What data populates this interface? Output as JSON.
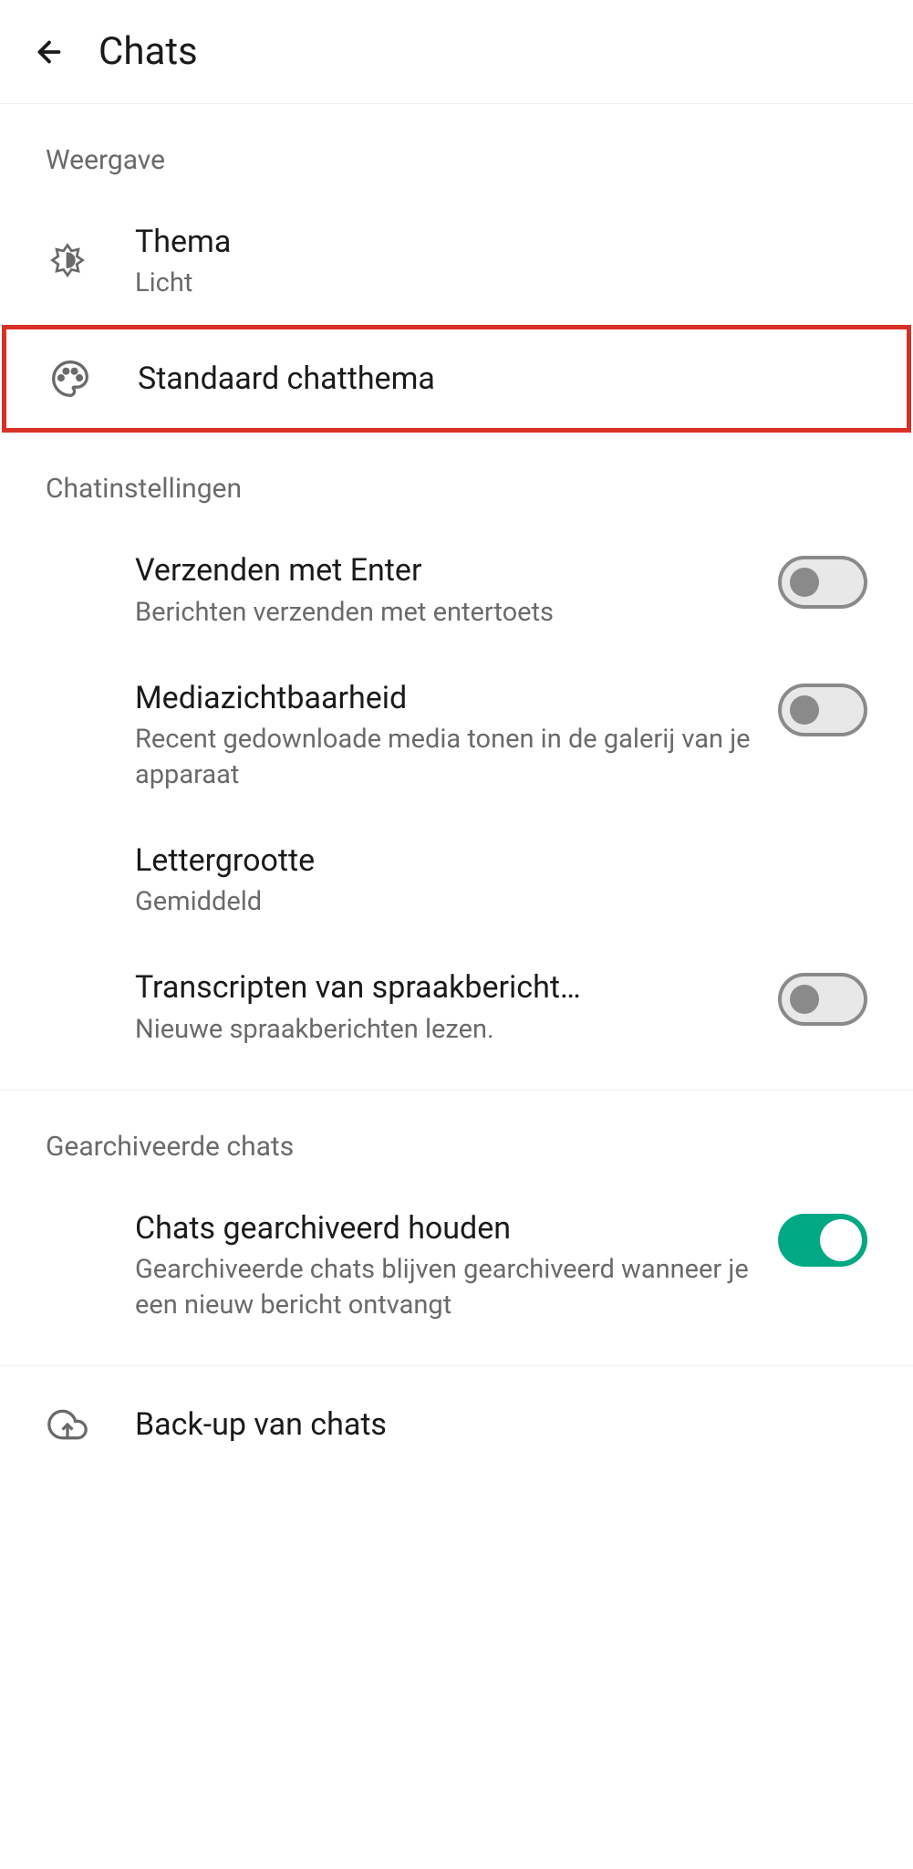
{
  "header": {
    "title": "Chats"
  },
  "sections": {
    "display": {
      "header": "Weergave",
      "theme": {
        "title": "Thema",
        "subtitle": "Licht"
      },
      "defaultChatTheme": {
        "title": "Standaard chatthema"
      }
    },
    "chatSettings": {
      "header": "Chatinstellingen",
      "enterToSend": {
        "title": "Verzenden met Enter",
        "subtitle": "Berichten verzenden met entertoets",
        "enabled": false
      },
      "mediaVisibility": {
        "title": "Mediazichtbaarheid",
        "subtitle": "Recent gedownloade media tonen in de galerij van je apparaat",
        "enabled": false
      },
      "fontSize": {
        "title": "Lettergrootte",
        "subtitle": "Gemiddeld"
      },
      "voiceTranscripts": {
        "title": "Transcripten van spraakbericht…",
        "subtitle": "Nieuwe spraakberichten lezen.",
        "enabled": false
      }
    },
    "archivedChats": {
      "header": "Gearchiveerde chats",
      "keepArchived": {
        "title": "Chats gearchiveerd houden",
        "subtitle": "Gearchiveerde chats blijven gearchiveerd wanneer je een nieuw bericht ontvangt",
        "enabled": true
      }
    },
    "backup": {
      "title": "Back-up van chats"
    }
  }
}
